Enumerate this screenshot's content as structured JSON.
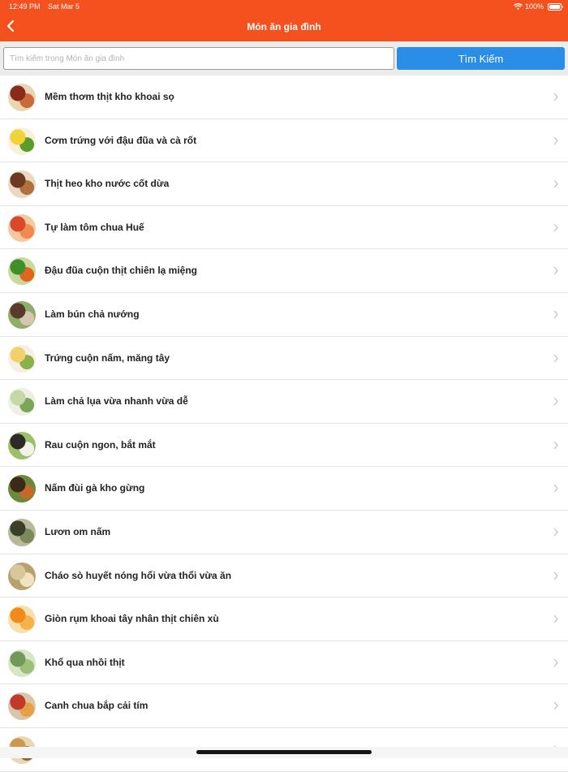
{
  "status": {
    "time": "12:49 PM",
    "date": "Sat Mar 5",
    "battery": "100%"
  },
  "header": {
    "title": "Món ăn gia đình",
    "back_icon": "chevron-left-icon"
  },
  "search": {
    "placeholder": "Tìm kiếm trong Món ăn gia đình",
    "button_label": "Tìm Kiếm"
  },
  "colors": {
    "accent": "#f4511e",
    "button": "#2a8ee6"
  },
  "items": [
    {
      "label": "Mềm thơm thịt kho khoai sọ",
      "thumb": [
        "#8b2a1a",
        "#c96a3a",
        "#e8d6b0"
      ]
    },
    {
      "label": "Cơm trứng với đậu đũa và cà rốt",
      "thumb": [
        "#f1d23a",
        "#5a9c2e",
        "#f6f1d8"
      ]
    },
    {
      "label": "Thịt heo kho nước cốt dừa",
      "thumb": [
        "#6b3a1f",
        "#b07040",
        "#e9d9c2"
      ]
    },
    {
      "label": "Tự làm tôm chua Huế",
      "thumb": [
        "#d9482a",
        "#f08a52",
        "#f5c9a0"
      ]
    },
    {
      "label": "Đậu đũa cuộn thịt chiên lạ miệng",
      "thumb": [
        "#3f8f2a",
        "#e0651e",
        "#c9d99a"
      ]
    },
    {
      "label": "Làm bún chả nướng",
      "thumb": [
        "#5a3a2a",
        "#d6c6b0",
        "#8fae6a"
      ]
    },
    {
      "label": "Trứng cuộn nấm, măng tây",
      "thumb": [
        "#f2d06a",
        "#8bb24a",
        "#f6efe2"
      ]
    },
    {
      "label": "Làm chả lụa vừa nhanh vừa dễ",
      "thumb": [
        "#c6d8a8",
        "#7aa65a",
        "#eef0e4"
      ]
    },
    {
      "label": "Rau cuộn ngon, bắt mắt",
      "thumb": [
        "#2f2a28",
        "#f4f0ea",
        "#9cc06a"
      ]
    },
    {
      "label": "Nấm đùi gà kho gừng",
      "thumb": [
        "#3a2a1a",
        "#c26a2a",
        "#6a8a3a"
      ]
    },
    {
      "label": "Lươn om nấm",
      "thumb": [
        "#3a3f2a",
        "#7a8a5a",
        "#b8b89a"
      ]
    },
    {
      "label": "Cháo sò huyết nóng hổi vừa thổi vừa ăn",
      "thumb": [
        "#d8c79a",
        "#efe3c0",
        "#b9a070"
      ]
    },
    {
      "label": "Giòn rụm khoai tây nhân thịt chiên xù",
      "thumb": [
        "#f28a1a",
        "#f6b24a",
        "#f7e0b0"
      ]
    },
    {
      "label": "Khổ qua nhồi thịt",
      "thumb": [
        "#6f9a5a",
        "#9cc07a",
        "#d8e6c6"
      ]
    },
    {
      "label": "Canh chua bắp cải tím",
      "thumb": [
        "#c0392b",
        "#e6a04a",
        "#d8c6a8"
      ]
    },
    {
      "label": "",
      "thumb": [
        "#c89a4a",
        "#8a6a3a",
        "#e8d8b8"
      ]
    }
  ]
}
